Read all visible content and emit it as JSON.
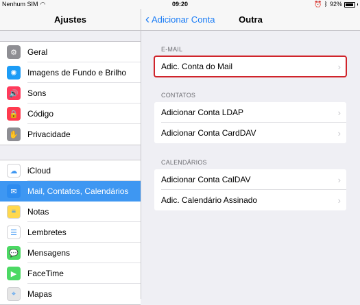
{
  "status": {
    "carrier": "Nenhum SIM",
    "time": "09:20",
    "battery": "92%"
  },
  "left": {
    "title": "Ajustes",
    "group1": [
      {
        "label": "Geral",
        "icon": "gear-icon",
        "color": "#8e8e93",
        "glyph": "⚙"
      },
      {
        "label": "Imagens de Fundo e Brilho",
        "icon": "wallpaper-icon",
        "color": "#1c9cf6",
        "glyph": "✺"
      },
      {
        "label": "Sons",
        "icon": "sound-icon",
        "color": "#ff3b5c",
        "glyph": "🔊"
      },
      {
        "label": "Código",
        "icon": "lock-icon",
        "color": "#ff3b4f",
        "glyph": "🔒"
      },
      {
        "label": "Privacidade",
        "icon": "hand-icon",
        "color": "#8e8e93",
        "glyph": "✋"
      }
    ],
    "group2": [
      {
        "label": "iCloud",
        "icon": "cloud-icon",
        "color": "#ffffff",
        "glyph": "☁"
      },
      {
        "label": "Mail, Contatos, Calendários",
        "icon": "mail-icon",
        "color": "#2d8cf0",
        "glyph": "✉"
      },
      {
        "label": "Notas",
        "icon": "notes-icon",
        "color": "#ffd84d",
        "glyph": "≡"
      },
      {
        "label": "Lembretes",
        "icon": "reminders-icon",
        "color": "#ffffff",
        "glyph": "☰"
      },
      {
        "label": "Mensagens",
        "icon": "messages-icon",
        "color": "#4cd964",
        "glyph": "💬"
      },
      {
        "label": "FaceTime",
        "icon": "facetime-icon",
        "color": "#4cd964",
        "glyph": "▶"
      },
      {
        "label": "Mapas",
        "icon": "maps-icon",
        "color": "#e5e5e5",
        "glyph": "⌖"
      }
    ]
  },
  "right": {
    "back_label": "Adicionar Conta",
    "title": "Outra",
    "sections": [
      {
        "header": "E-MAIL",
        "rows": [
          "Adic. Conta do Mail"
        ]
      },
      {
        "header": "CONTATOS",
        "rows": [
          "Adicionar Conta LDAP",
          "Adicionar Conta CardDAV"
        ]
      },
      {
        "header": "CALENDÁRIOS",
        "rows": [
          "Adicionar Conta CalDAV",
          "Adic. Calendário Assinado"
        ]
      }
    ]
  }
}
